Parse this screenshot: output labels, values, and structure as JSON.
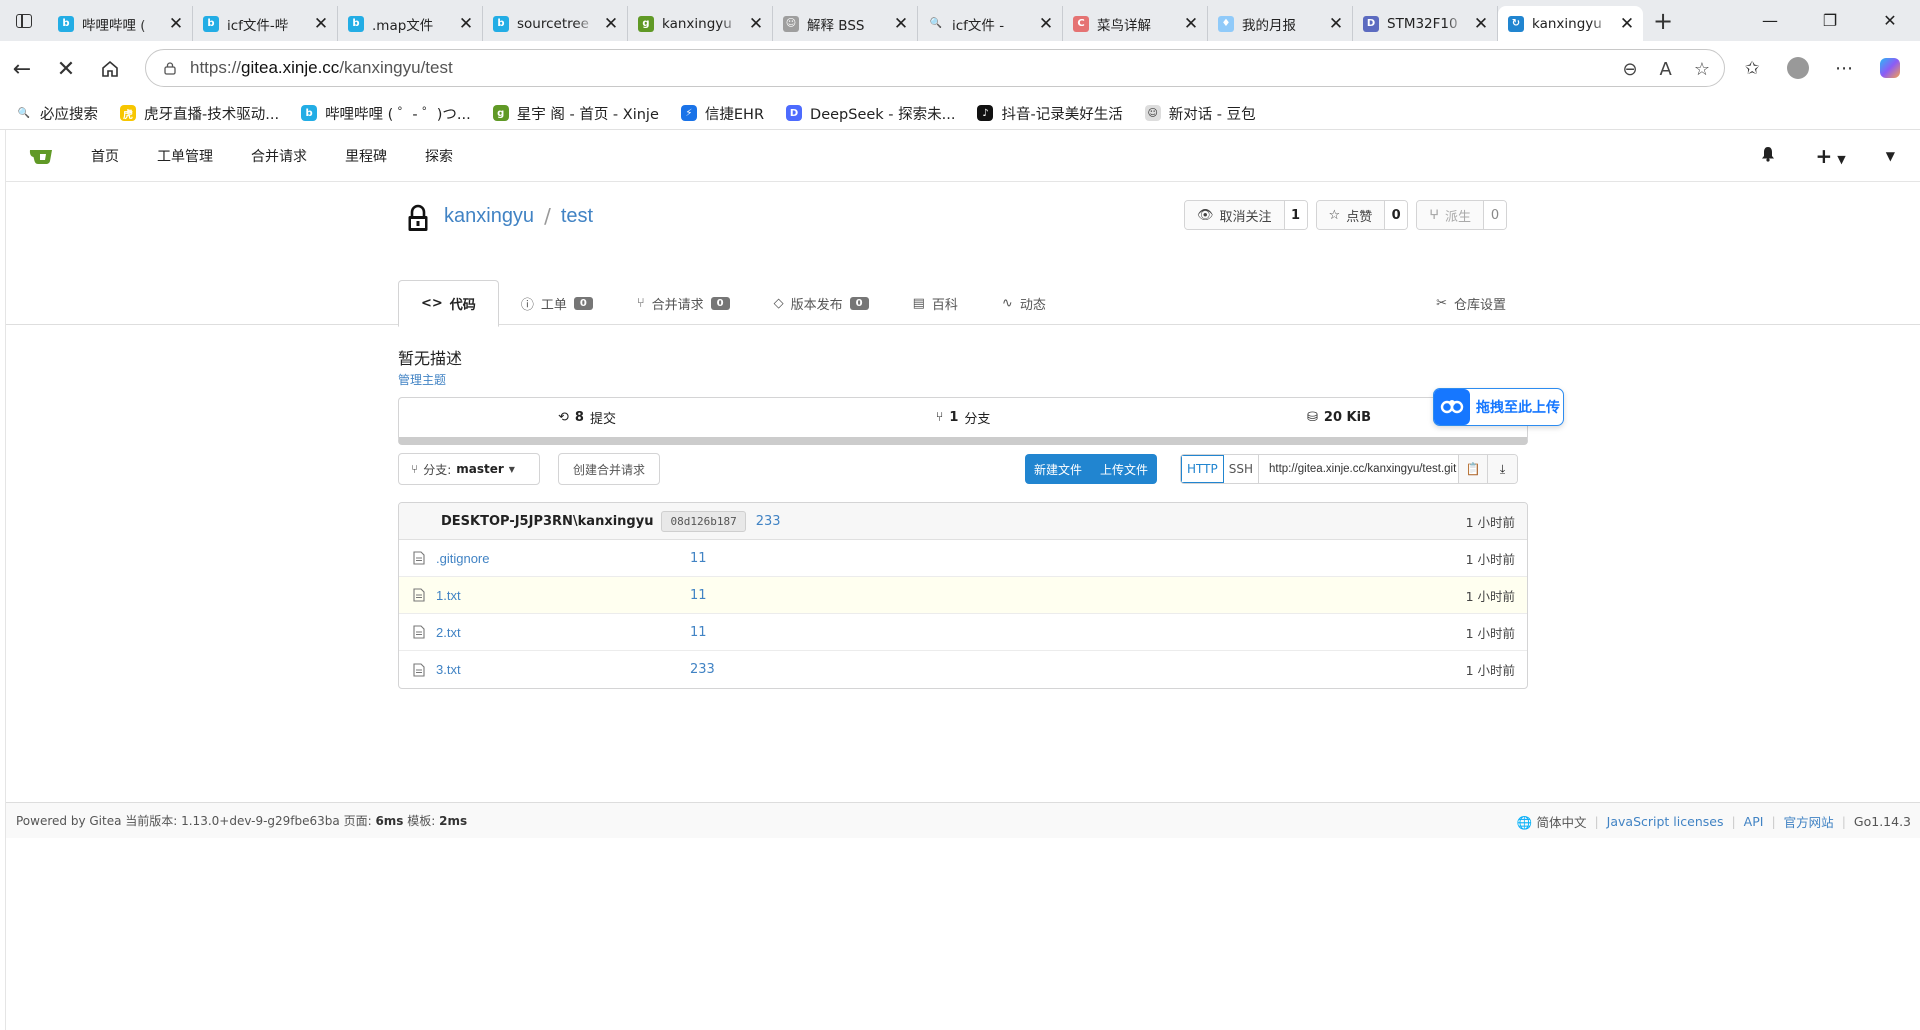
{
  "browser": {
    "tabs": [
      {
        "title": "哔哩哔哩 (",
        "fav_color": "#23ade5",
        "fav_glyph": "b"
      },
      {
        "title": "icf文件-哔",
        "fav_color": "#23ade5",
        "fav_glyph": "b"
      },
      {
        "title": ".map文件",
        "fav_color": "#23ade5",
        "fav_glyph": "b"
      },
      {
        "title": "sourcetree",
        "fav_color": "#23ade5",
        "fav_glyph": "b"
      },
      {
        "title": "kanxingyu",
        "fav_color": "#609926",
        "fav_glyph": "g"
      },
      {
        "title": "解释 BSS",
        "fav_color": "#9e9e9e",
        "fav_glyph": "☺"
      },
      {
        "title": "icf文件 -",
        "fav_color": "#e9ebee",
        "fav_glyph": "🔍"
      },
      {
        "title": "菜鸟详解",
        "fav_color": "#e57373",
        "fav_glyph": "C"
      },
      {
        "title": "我的月报",
        "fav_color": "#90caf9",
        "fav_glyph": "♦"
      },
      {
        "title": "STM32F10",
        "fav_color": "#5c6bc0",
        "fav_glyph": "D"
      },
      {
        "title": "kanxingyu",
        "fav_color": "#2185d0",
        "fav_glyph": "↻",
        "active": true
      }
    ],
    "url_prefix": "https://",
    "url_host": "gitea.xinje.cc",
    "url_path": "/kanxingyu/test",
    "bookmarks": [
      {
        "label": "必应搜索",
        "fav_color": "#fff",
        "fav_glyph": "🔍",
        "text_color": "#1a73e8"
      },
      {
        "label": "虎牙直播-技术驱动...",
        "fav_color": "#f7c600",
        "fav_glyph": "虎",
        "text_color": "#fff"
      },
      {
        "label": "哔哩哔哩 ( ゜- ゜)つ...",
        "fav_color": "#23ade5",
        "fav_glyph": "b",
        "text_color": "#fff"
      },
      {
        "label": "星宇 阁 - 首页 - Xinje",
        "fav_color": "#609926",
        "fav_glyph": "g",
        "text_color": "#fff"
      },
      {
        "label": "信捷EHR",
        "fav_color": "#1a73e8",
        "fav_glyph": "⚡",
        "text_color": "#fff"
      },
      {
        "label": "DeepSeek - 探索未...",
        "fav_color": "#4d6bfe",
        "fav_glyph": "D",
        "text_color": "#fff"
      },
      {
        "label": "抖音-记录美好生活",
        "fav_color": "#111",
        "fav_glyph": "♪",
        "text_color": "#fff"
      },
      {
        "label": "新对话 - 豆包",
        "fav_color": "#ddd",
        "fav_glyph": "☺",
        "text_color": "#333"
      }
    ]
  },
  "nav": {
    "items": [
      "首页",
      "工单管理",
      "合并请求",
      "里程碑",
      "探索"
    ],
    "plus": "+"
  },
  "repo": {
    "owner": "kanxingyu",
    "sep": "/",
    "name": "test",
    "watch_label": "取消关注",
    "watch_count": "1",
    "star_label": "点赞",
    "star_count": "0",
    "fork_label": "派生",
    "fork_count": "0",
    "tabs": [
      {
        "label": "代码",
        "icon": "code-icon",
        "active": true
      },
      {
        "label": "工单",
        "icon": "issue-icon",
        "badge": "0"
      },
      {
        "label": "合并请求",
        "icon": "pull-request-icon",
        "badge": "0"
      },
      {
        "label": "版本发布",
        "icon": "tag-icon",
        "badge": "0"
      },
      {
        "label": "百科",
        "icon": "book-icon"
      },
      {
        "label": "动态",
        "icon": "pulse-icon"
      }
    ],
    "settings_label": "仓库设置",
    "description": "暂无描述",
    "manage_topics": "管理主题",
    "commits_count": "8",
    "commits_label": "提交",
    "branches_count": "1",
    "branches_label": "分支",
    "size": "20 KiB",
    "branch_prefix": "分支:",
    "branch_name": "master",
    "new_pull_label": "创建合并请求",
    "new_file_label": "新建文件",
    "upload_file_label": "上传文件",
    "clone_http": "HTTP",
    "clone_ssh": "SSH",
    "clone_url": "http://gitea.xinje.cc/kanxingyu/test.git",
    "last_commit": {
      "author": "DESKTOP-J5JP3RN\\kanxingyu",
      "sha": "08d126b187",
      "message": "233",
      "time": "1 小时前"
    },
    "files": [
      {
        "name": ".gitignore",
        "message": "11",
        "time": "1 小时前"
      },
      {
        "name": "1.txt",
        "message": "11",
        "time": "1 小时前",
        "highlight": true
      },
      {
        "name": "2.txt",
        "message": "11",
        "time": "1 小时前"
      },
      {
        "name": "3.txt",
        "message": "233",
        "time": "1 小时前"
      }
    ]
  },
  "upload_float": "拖拽至此上传",
  "footer": {
    "powered": "Powered by Gitea 当前版本: 1.13.0+dev-9-g29fbe63ba 页面:",
    "page_time": "6ms",
    "tmpl_label": "模板:",
    "tmpl_time": "2ms",
    "lang": "简体中文",
    "js_licenses": "JavaScript licenses",
    "api": "API",
    "website": "官方网站",
    "go_version": "Go1.14.3"
  },
  "colors": {
    "link": "#4183c4",
    "primary_button": "#2185d0",
    "gitea_green": "#609926"
  }
}
